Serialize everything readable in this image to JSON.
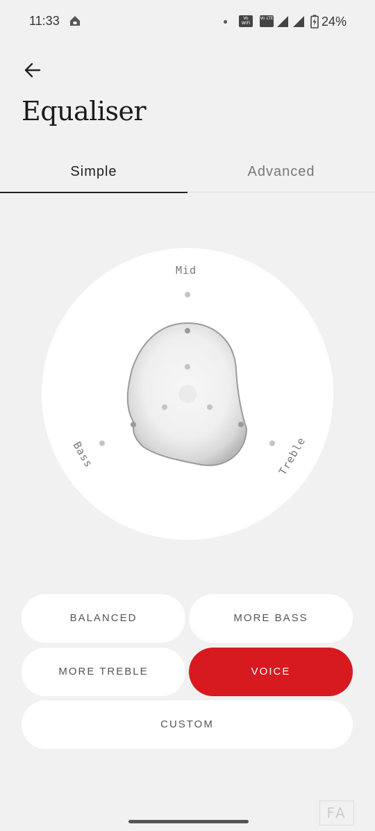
{
  "status_bar": {
    "time": "11:33",
    "volte_wifi": "Vo WiFi",
    "volte_lte": "Vo LTE",
    "battery_pct": "24%"
  },
  "header": {
    "title": "Equaliser",
    "back_icon": "back-arrow-icon"
  },
  "tabs": [
    {
      "label": "Simple",
      "selected": true
    },
    {
      "label": "Advanced",
      "selected": false
    }
  ],
  "equaliser": {
    "axis_labels": {
      "mid": "Mid",
      "bass": "Bass",
      "treble": "Treble"
    }
  },
  "presets": [
    {
      "label": "BALANCED",
      "selected": false
    },
    {
      "label": "MORE BASS",
      "selected": false
    },
    {
      "label": "MORE TREBLE",
      "selected": false
    },
    {
      "label": "VOICE",
      "selected": true
    },
    {
      "label": "CUSTOM",
      "selected": false
    }
  ],
  "colors": {
    "accent": "#d71920",
    "background": "#f1f1f1",
    "card": "#ffffff"
  },
  "overlay_badge": "FA"
}
